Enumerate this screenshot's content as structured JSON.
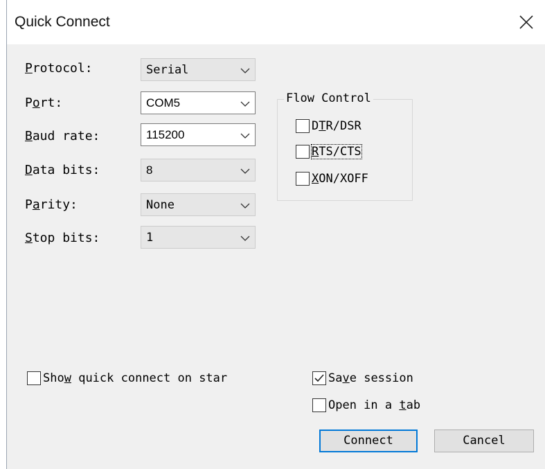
{
  "dialog": {
    "title": "Quick Connect",
    "close_icon": "close-icon"
  },
  "fields": [
    {
      "id": "protocol",
      "label_acc": "P",
      "label_rest": "rotocol:",
      "value": "Serial",
      "editable": false
    },
    {
      "id": "port",
      "label_pre": "P",
      "label_acc": "o",
      "label_rest": "rt:",
      "value": "COM5",
      "editable": true
    },
    {
      "id": "baud",
      "label_acc": "B",
      "label_rest": "aud rate:",
      "value": "115200",
      "editable": true
    },
    {
      "id": "databits",
      "label_acc": "D",
      "label_rest": "ata bits:",
      "value": "8",
      "editable": false
    },
    {
      "id": "parity",
      "label_pre": "P",
      "label_acc": "a",
      "label_rest": "rity:",
      "value": "None",
      "editable": false
    },
    {
      "id": "stopbits",
      "label_acc": "S",
      "label_rest": "top bits:",
      "value": "1",
      "editable": false
    }
  ],
  "flow_control": {
    "title": "Flow Control",
    "options": [
      {
        "pre": "D",
        "acc": "T",
        "rest": "R/DSR",
        "checked": false
      },
      {
        "pre": "",
        "acc": "R",
        "rest": "TS/CTS",
        "checked": false
      },
      {
        "pre": "",
        "acc": "X",
        "rest": "ON/XOFF",
        "checked": false
      }
    ]
  },
  "options": {
    "show_quick_connect": {
      "pre": "Sho",
      "acc": "w",
      "rest": " quick connect on star",
      "checked": false
    },
    "save_session": {
      "pre": "Sa",
      "acc": "v",
      "rest": "e session",
      "checked": true
    },
    "open_in_tab": {
      "pre": "Open in a ",
      "acc": "t",
      "rest": "ab",
      "checked": false
    }
  },
  "buttons": {
    "connect": "Connect",
    "cancel": "Cancel"
  },
  "colors": {
    "accent": "#0078d7",
    "dialog_bg": "#f0f0f0"
  }
}
